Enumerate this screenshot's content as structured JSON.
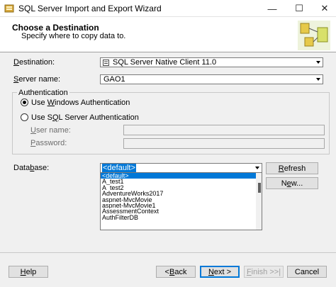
{
  "window": {
    "title": "SQL Server Import and Export Wizard",
    "minimize_glyph": "—",
    "maximize_glyph": "☐",
    "close_glyph": "✕"
  },
  "header": {
    "title": "Choose a Destination",
    "subtitle": "Specify where to copy data to."
  },
  "destination": {
    "label_pre": "",
    "label_ul": "D",
    "label_post": "estination:",
    "value": "SQL Server Native Client 11.0"
  },
  "server": {
    "label_pre": "",
    "label_ul": "S",
    "label_post": "erver name:",
    "value": "GAO1"
  },
  "authentication": {
    "caption": "Authentication",
    "windows_pre": "Use ",
    "windows_ul": "W",
    "windows_post": "indows Authentication",
    "windows_selected": true,
    "sql_pre": "Use S",
    "sql_ul": "Q",
    "sql_post": "L Server Authentication",
    "username_pre": "",
    "username_ul": "U",
    "username_post": "ser name:",
    "password_pre": "",
    "password_ul": "P",
    "password_post": "assword:"
  },
  "database": {
    "label_pre": "Data",
    "label_ul": "b",
    "label_post": "ase:",
    "value": "<default>",
    "options": [
      "<default>",
      "A_test1",
      "A_test2",
      "AdventureWorks2017",
      "aspnet-MvcMovie",
      "aspnet-MvcMovie1",
      "AssessmentContext",
      "AuthFilterDB"
    ],
    "refresh_pre": "",
    "refresh_ul": "R",
    "refresh_post": "efresh",
    "new_pre": "N",
    "new_ul": "e",
    "new_post": "w..."
  },
  "footer": {
    "help_pre": "",
    "help_ul": "H",
    "help_post": "elp",
    "back_pre": "< ",
    "back_ul": "B",
    "back_post": "ack",
    "next_pre": "",
    "next_ul": "N",
    "next_post": "ext >",
    "finish_pre": "",
    "finish_ul": "F",
    "finish_post": "inish >>|",
    "cancel_label": "Cancel"
  },
  "colors": {
    "accent": "#0078d7",
    "window_bg": "#f0f0f0",
    "header_bg": "#ffffff"
  }
}
